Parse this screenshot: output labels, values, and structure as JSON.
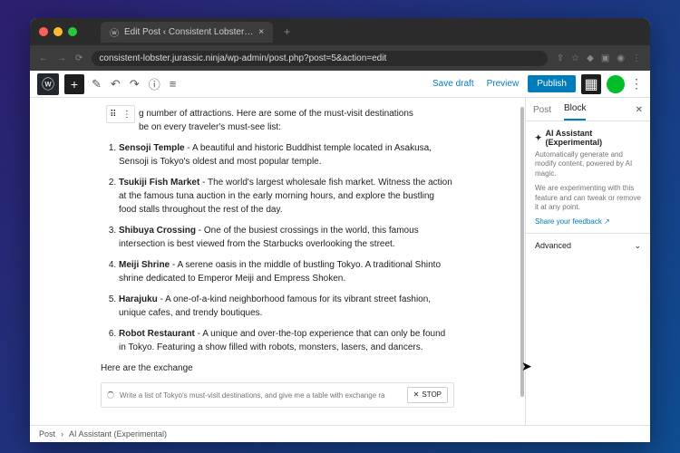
{
  "browser": {
    "tab_title": "Edit Post ‹ Consistent Lobster…",
    "close_x": "×",
    "plus": "+",
    "url": "consistent-lobster.jurassic.ninja/wp-admin/post.php?post=5&action=edit"
  },
  "toolbar": {
    "save_draft": "Save draft",
    "preview": "Preview",
    "publish": "Publish"
  },
  "sidebar": {
    "tab_post": "Post",
    "tab_block": "Block",
    "ai_title": "AI Assistant (Experimental)",
    "ai_desc": "Automatically generate and modify content, powered by AI magic.",
    "ai_warn": "We are experimenting with this feature and can tweak or remove it at any point.",
    "ai_link": "Share your feedback ↗",
    "advanced": "Advanced"
  },
  "content": {
    "intro_tail": "g number of attractions. Here are some of the must-visit destinations",
    "intro_tail2": "be on every traveler's must-see list:",
    "items": [
      {
        "title": "Sensoji Temple",
        "body": " - A beautiful and historic Buddhist temple located in Asakusa, Sensoji is Tokyo's oldest and most popular temple."
      },
      {
        "title": "Tsukiji Fish Market",
        "body": " - The world's largest wholesale fish market. Witness the action at the famous tuna auction in the early morning hours, and explore the bustling food stalls throughout the rest of the day."
      },
      {
        "title": "Shibuya Crossing",
        "body": " - One of the busiest crossings in the world, this famous intersection is best viewed from the Starbucks overlooking the street."
      },
      {
        "title": "Meiji Shrine",
        "body": " - A serene oasis in the middle of bustling Tokyo. A traditional Shinto shrine dedicated to Emperor Meiji and Empress Shoken."
      },
      {
        "title": "Harajuku",
        "body": " - A one-of-a-kind neighborhood famous for its vibrant street fashion, unique cafes, and trendy boutiques."
      },
      {
        "title": "Robot Restaurant",
        "body": " - A unique and over-the-top experience that can only be found in Tokyo. Featuring a show filled with robots, monsters, lasers, and dancers."
      }
    ],
    "after": "Here are the exchange",
    "ai_placeholder": "Write a list of Tokyo's must-visit destinations, and give me a table with exchange ra",
    "stop": "STOP"
  },
  "breadcrumb": {
    "root": "Post",
    "sep": "›",
    "current": "AI Assistant (Experimental)"
  }
}
